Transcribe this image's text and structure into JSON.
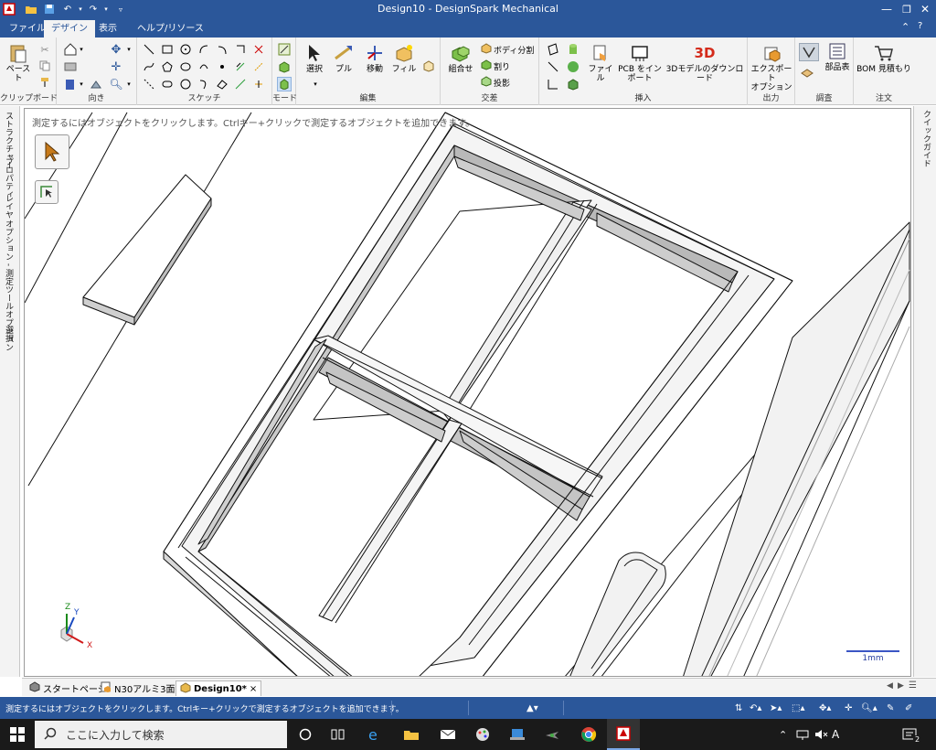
{
  "window": {
    "title": "Design10 - DesignSpark Mechanical"
  },
  "menu": {
    "tabs": [
      {
        "label": "ファイル"
      },
      {
        "label": "デザイン"
      },
      {
        "label": "表示"
      },
      {
        "label": "ヘルプ/リソース"
      }
    ],
    "active_tab": "デザイン"
  },
  "ribbon": {
    "clipboard": {
      "label": "クリップボード",
      "paste": "ペースト"
    },
    "orient": {
      "label": "向き"
    },
    "sketch": {
      "label": "スケッチ"
    },
    "mode": {
      "label": "モード"
    },
    "edit": {
      "label": "編集",
      "select": "選択",
      "pull": "プル",
      "move": "移動",
      "fill": "フィル"
    },
    "intersect": {
      "label": "交差",
      "combine": "組合せ",
      "split_body": "ボディ分割",
      "split": "割り",
      "project": "投影"
    },
    "insert": {
      "label": "挿入",
      "file": "ファイル",
      "pcb": "PCB をインポート",
      "download3d": "3Dモデルのダウンロード",
      "badge3d": "3D"
    },
    "output": {
      "label": "出力",
      "export": "エクスポート",
      "options": "オプション"
    },
    "inspect": {
      "label": "調査",
      "bom_table": "部品表"
    },
    "order": {
      "label": "注文",
      "bom_quote": "BOM 見積もり"
    }
  },
  "left_panel": {
    "tabs": [
      "ストラクチャー",
      "プロパティ",
      "レイヤ",
      "オプション - 測定ツールオプション",
      "選択"
    ]
  },
  "right_panel": {
    "tabs": [
      "クイックガイド"
    ]
  },
  "viewport": {
    "hint": "測定するにはオブジェクトをクリックします。Ctrlキー+クリックで測定するオブジェクトを追加できます。",
    "scale_label": "1mm",
    "axes": {
      "x": "X",
      "y": "Y",
      "z": "Z"
    }
  },
  "doc_tabs": [
    {
      "label": "スタートページ",
      "active": false
    },
    {
      "label": "N30アルミ3面*",
      "active": false
    },
    {
      "label": "Design10*",
      "active": true
    }
  ],
  "status": {
    "message": "測定するにはオブジェクトをクリックします。Ctrlキー+クリックで測定するオブジェクトを追加できます。"
  },
  "taskbar": {
    "search_placeholder": "ここに入力して検索",
    "ime": "A",
    "notification_count": "2"
  },
  "colors": {
    "title_bar": "#2b579a",
    "ribbon_bg": "#f3f3f3",
    "taskbar": "#1a1a1a",
    "accent": "#2b579a"
  }
}
